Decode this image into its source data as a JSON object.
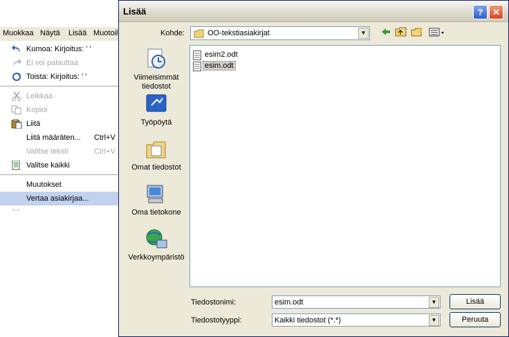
{
  "menubar": {
    "items": [
      {
        "label": "Muokkaa",
        "accel": "M",
        "rest": "uokkaa"
      },
      {
        "label": "Näytä",
        "accel": "N",
        "rest": "äytä"
      },
      {
        "label": "Lisää",
        "accel": "L",
        "rest": "isää"
      },
      {
        "label": "Muotoile",
        "accel": "M",
        "rest": "uotoil"
      }
    ]
  },
  "edit_menu": {
    "items": [
      {
        "label": "Kumoa: Kirjoitus: ' '",
        "shortcut": "",
        "enabled": true,
        "icon": "undo-icon"
      },
      {
        "label": "Ei voi palauttaa",
        "shortcut": "",
        "enabled": false,
        "icon": "redo-icon"
      },
      {
        "label": "Toista: Kirjoitus: ' '",
        "shortcut": "",
        "enabled": true,
        "icon": "repeat-icon"
      },
      {
        "label": "Leikkaa",
        "shortcut": "",
        "enabled": false,
        "icon": "cut-icon"
      },
      {
        "label": "Kopioi",
        "shortcut": "",
        "enabled": false,
        "icon": "copy-icon"
      },
      {
        "label": "Liitä",
        "shortcut": "",
        "enabled": true,
        "icon": "paste-icon"
      },
      {
        "label": "Liitä määräten...",
        "shortcut": "Ctrl+V",
        "enabled": true,
        "icon": ""
      },
      {
        "label": "Valitse teksti",
        "shortcut": "Ctrl+V",
        "enabled": false,
        "icon": ""
      },
      {
        "label": "Valitse kaikki",
        "shortcut": "",
        "enabled": true,
        "icon": "select-all-icon"
      },
      {
        "label": "Muutokset",
        "shortcut": "",
        "enabled": true,
        "icon": ""
      },
      {
        "label": "Vertaa asiakirjaa...",
        "shortcut": "",
        "enabled": true,
        "icon": ""
      }
    ]
  },
  "dialog": {
    "title": "Lisää",
    "help_label": "?",
    "close_label": "✕",
    "look_in_label": "Kohde:",
    "look_in_value": "OO-tekstiasiakirjat",
    "places": [
      {
        "label": "Viimeisimmät tiedostot",
        "icon": "recent-documents-icon"
      },
      {
        "label": "Työpöytä",
        "icon": "desktop-icon"
      },
      {
        "label": "Omat tiedostot",
        "icon": "my-documents-icon"
      },
      {
        "label": "Oma tietokone",
        "icon": "my-computer-icon"
      },
      {
        "label": "Verkkoympäristö",
        "icon": "network-places-icon"
      }
    ],
    "files": [
      {
        "name": "esim2.odt",
        "selected": false
      },
      {
        "name": "esim.odt",
        "selected": true
      }
    ],
    "filename_label": "Tiedostonimi:",
    "filename_value": "esim.odt",
    "filetype_label": "Tiedostotyyppi:",
    "filetype_value": "Kaikki tiedostot (*.*)",
    "insert_button": "Lisää",
    "cancel_button": "Peruuta"
  }
}
